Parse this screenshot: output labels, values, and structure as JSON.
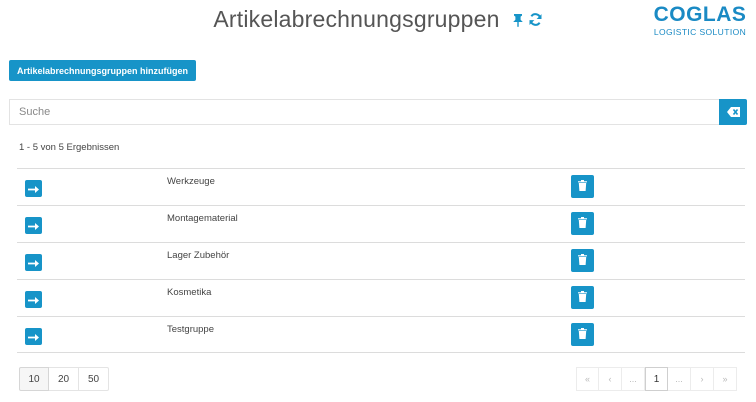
{
  "header": {
    "title": "Artikelabrechnungsgruppen",
    "pin_icon": "pin-icon",
    "refresh_icon": "refresh-icon"
  },
  "logo": {
    "main": "COGLAS",
    "sub": "LOGISTIC SOLUTION"
  },
  "toolbar": {
    "add_label": "Artikelabrechnungsgruppen hinzufügen"
  },
  "search": {
    "placeholder": "Suche",
    "value": "",
    "clear_icon": "eraser-icon"
  },
  "results": {
    "summary": "1 - 5 von 5 Ergebnissen"
  },
  "rows": [
    {
      "name": "Werkzeuge"
    },
    {
      "name": "Montagematerial"
    },
    {
      "name": "Lager Zubehör"
    },
    {
      "name": "Kosmetika"
    },
    {
      "name": "Testgruppe"
    }
  ],
  "page_size": {
    "options": [
      "10",
      "20",
      "50"
    ],
    "selected": "10"
  },
  "pagination": {
    "first": "«",
    "prev": "‹",
    "ellipsis_before": "...",
    "current": "1",
    "ellipsis_after": "...",
    "next": "›",
    "last": "»"
  },
  "colors": {
    "accent": "#1794c8",
    "brand": "#1a8ac4"
  }
}
